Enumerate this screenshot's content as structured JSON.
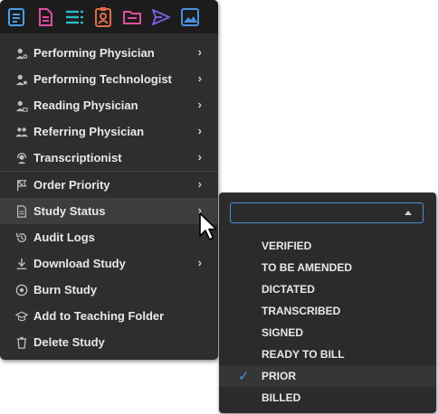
{
  "toolbar": {
    "icons": [
      {
        "name": "report-icon",
        "color": "#4a9fe8"
      },
      {
        "name": "document-icon",
        "color": "#e04ea0"
      },
      {
        "name": "list-icon",
        "color": "#2bb8c8"
      },
      {
        "name": "contact-icon",
        "color": "#e06a4a"
      },
      {
        "name": "folder-icon",
        "color": "#e04ea0"
      },
      {
        "name": "send-icon",
        "color": "#7b5ae0"
      },
      {
        "name": "image-icon",
        "color": "#4a8fe0"
      }
    ]
  },
  "menu": {
    "items": [
      {
        "label": "Performing Physician",
        "icon": "physician-icon",
        "has_submenu": true
      },
      {
        "label": "Performing Technologist",
        "icon": "technologist-icon",
        "has_submenu": true
      },
      {
        "label": "Reading Physician",
        "icon": "reading-physician-icon",
        "has_submenu": true
      },
      {
        "label": "Referring Physician",
        "icon": "referring-physician-icon",
        "has_submenu": true
      },
      {
        "label": "Transcriptionist",
        "icon": "headset-icon",
        "has_submenu": true
      },
      {
        "label": "Order Priority",
        "icon": "flag-icon",
        "has_submenu": true
      },
      {
        "label": "Study Status",
        "icon": "document-icon",
        "has_submenu": true
      },
      {
        "label": "Audit Logs",
        "icon": "history-icon",
        "has_submenu": false
      },
      {
        "label": "Download Study",
        "icon": "download-icon",
        "has_submenu": true
      },
      {
        "label": "Burn Study",
        "icon": "disc-icon",
        "has_submenu": false
      },
      {
        "label": "Add to Teaching Folder",
        "icon": "graduation-cap-icon",
        "has_submenu": false
      },
      {
        "label": "Delete Study",
        "icon": "trash-icon",
        "has_submenu": false
      }
    ],
    "chevron": "›"
  },
  "submenu": {
    "select_value": "",
    "options": [
      "VERIFIED",
      "TO BE AMENDED",
      "DICTATED",
      "TRANSCRIBED",
      "SIGNED",
      "READY TO BILL",
      "PRIOR",
      "BILLED"
    ],
    "selected": "PRIOR",
    "check_mark": "✓"
  },
  "colors": {
    "menu_bg": "#2e2e2e",
    "toolbar_bg": "#1c1c1c",
    "accent": "#4a8fd6"
  }
}
